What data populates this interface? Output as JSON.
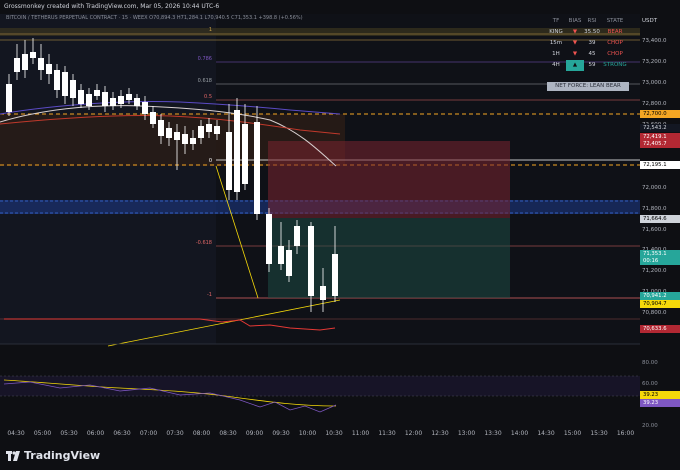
{
  "header": {
    "attribution": "Grossmonkey created with TradingView.com, Mar 05, 2026 10:44 UTC-6",
    "symbol_line": "BITCOIN / TETHERUS PERPETUAL CONTRACT · 15 · WEEX  O70,894.3  H71,284.1  L70,940.5  C71,353.1  +398.8 (+0.56%)"
  },
  "price_axis": {
    "currency": "USDT",
    "labels": [
      "73,400.0",
      "73,200.0",
      "73,000.0",
      "72,800.0",
      "72,600.0",
      "72,400.0",
      "72,200.0",
      "72,000.0",
      "71,800.0",
      "71,600.0",
      "71,400.0",
      "71,200.0",
      "71,000.0",
      "70,800.0"
    ],
    "tags": [
      {
        "text": "72,700.0",
        "bg": "#f5a623",
        "fg": "#000000"
      },
      {
        "text": "72,543.2",
        "bg": "#131722",
        "fg": "#d1d4dc"
      },
      {
        "text": "72,419.1",
        "bg": "#b22833",
        "fg": "#ffffff"
      },
      {
        "text": "72,405.7",
        "bg": "#b22833",
        "fg": "#ffffff"
      },
      {
        "text": "72,195.1",
        "bg": "#ffffff",
        "fg": "#000000"
      },
      {
        "text": "71,664.6",
        "bg": "#cfd3da",
        "fg": "#000000"
      },
      {
        "text": "71,353.1",
        "bg": "#26a69a",
        "fg": "#ffffff"
      },
      {
        "text": "00:16",
        "bg": "#26a69a",
        "fg": "#ffffff"
      },
      {
        "text": "70,941.2",
        "bg": "#26a69a",
        "fg": "#ffffff"
      },
      {
        "text": "70,904.7",
        "bg": "#f5d90a",
        "fg": "#000000"
      },
      {
        "text": "70,633.6",
        "bg": "#b22833",
        "fg": "#ffffff"
      }
    ]
  },
  "oscillator": {
    "axis_labels": [
      "80.00",
      "60.00",
      "40.00",
      "20.00"
    ],
    "tags": [
      {
        "text": "39.23",
        "bg": "#f5d90a",
        "fg": "#000000"
      },
      {
        "text": "39.23",
        "bg": "#7e57c2",
        "fg": "#ffffff"
      }
    ]
  },
  "fib_levels": [
    "1",
    "0.786",
    "0.618",
    "0.5",
    "0",
    "-0.618",
    "-1"
  ],
  "time_axis": [
    "04:30",
    "05:00",
    "05:30",
    "06:00",
    "06:30",
    "07:00",
    "07:30",
    "08:00",
    "08:30",
    "09:00",
    "09:30",
    "10:00",
    "10:30",
    "11:00",
    "11:30",
    "12:00",
    "12:30",
    "13:00",
    "13:30",
    "14:00",
    "14:30",
    "15:00",
    "15:30",
    "16:00"
  ],
  "bias_table": {
    "headers": [
      "TF",
      "BIAS",
      "RSI",
      "STATE"
    ],
    "rows": [
      {
        "tf": "KING",
        "bias": "▼",
        "rsi": "35.50",
        "state": "BEAR",
        "bias_color": "#ef5350",
        "state_color": "#ef5350"
      },
      {
        "tf": "15m",
        "bias": "▼",
        "rsi": "39",
        "state": "CHOP",
        "bias_color": "#ef5350",
        "state_color": "#ef5350"
      },
      {
        "tf": "1H",
        "bias": "▼",
        "rsi": "45",
        "state": "CHOP",
        "bias_color": "#ef5350",
        "state_color": "#ef5350"
      },
      {
        "tf": "4H",
        "bias": "▲",
        "rsi": "59",
        "state": "STRONG",
        "bias_color": "#26a69a",
        "state_color": "#26a69a"
      }
    ],
    "net_force": "NET FORCE: LEAN BEAR"
  },
  "brand": {
    "name": "TradingView"
  },
  "colors": {
    "up": "#26a69a",
    "down": "#ffffff",
    "bear": "#ef5350",
    "accent_orange": "#f5a623",
    "yellow": "#f5d90a",
    "purple": "#7e57c2"
  }
}
